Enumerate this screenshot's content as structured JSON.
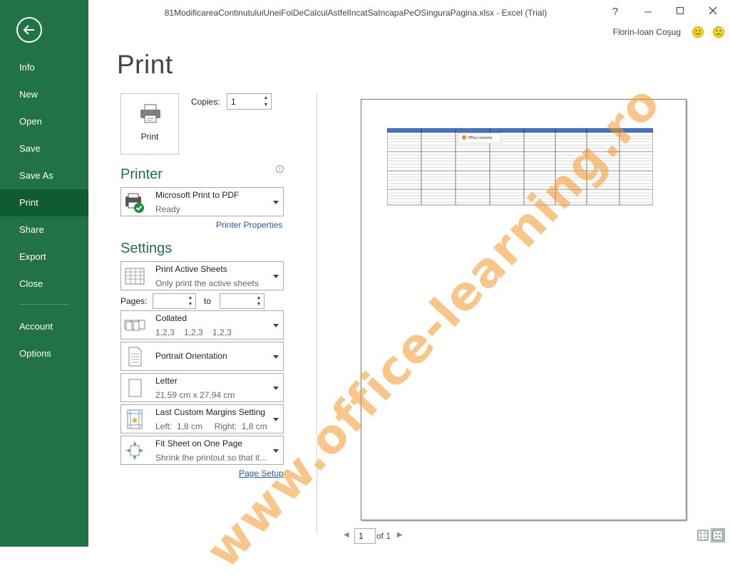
{
  "window": {
    "title": "81ModificareaContinutuluiUneiFoiDeCalculAstfelIncatSaIncapaPeOSinguraPagina.xlsx - Excel (Trial)",
    "help": "?",
    "user": "Florin-Ioan Coşug"
  },
  "sidebar": {
    "items": [
      {
        "label": "Info"
      },
      {
        "label": "New"
      },
      {
        "label": "Open"
      },
      {
        "label": "Save"
      },
      {
        "label": "Save As"
      },
      {
        "label": "Print"
      },
      {
        "label": "Share"
      },
      {
        "label": "Export"
      },
      {
        "label": "Close"
      },
      {
        "label": "Account"
      },
      {
        "label": "Options"
      }
    ],
    "active": "Print",
    "accent": "#217346",
    "active_color": "#0f5c32"
  },
  "print": {
    "page_title": "Print",
    "button_label": "Print",
    "copies_label": "Copies:",
    "copies_value": "1",
    "printer_section": "Printer",
    "printer_name": "Microsoft Print to PDF",
    "printer_status": "Ready",
    "printer_properties": "Printer Properties",
    "settings_section": "Settings",
    "what_to_print": {
      "title": "Print Active Sheets",
      "subtitle": "Only print the active sheets"
    },
    "pages_label": "Pages:",
    "pages_from": "",
    "to_label": "to",
    "pages_to": "",
    "collation": {
      "title": "Collated",
      "subtitle": "1,2,3    1,2,3    1,2,3"
    },
    "orientation": {
      "title": "Portrait Orientation"
    },
    "paper": {
      "title": "Letter",
      "subtitle": "21,59 cm x 27,94 cm"
    },
    "margins": {
      "title": "Last Custom Margins Setting",
      "subtitle": "Left:  1,8 cm     Right:  1,8 cm"
    },
    "scaling": {
      "title": "Fit Sheet on One Page",
      "subtitle": "Shrink the printout so that it..."
    },
    "page_setup": "Page Setup"
  },
  "preview": {
    "current_page": "1",
    "of_label": "of 1",
    "thumbnail_logo": "Office-Learning"
  },
  "watermark": {
    "text": "www.office-learning.ro"
  },
  "icons": {
    "back": "back-arrow-icon",
    "minimize": "minimize-icon",
    "maximize": "maximize-icon",
    "close": "close-icon",
    "printer": "printer-icon",
    "happy": "smiley-happy-icon",
    "sad": "smiley-sad-icon"
  }
}
